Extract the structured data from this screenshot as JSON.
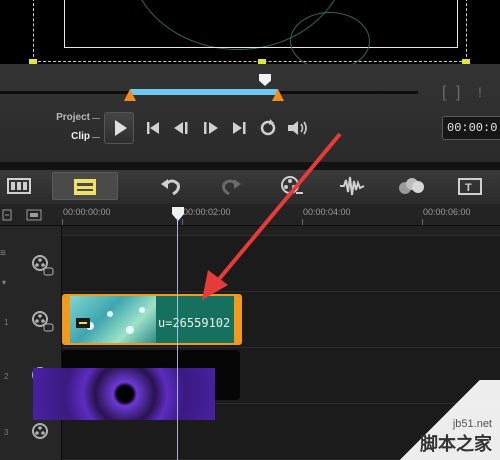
{
  "transport": {
    "project_label": "Project",
    "clip_label": "Clip",
    "timecode": "00:00:0",
    "bracket_in": "[",
    "bracket_out": "]"
  },
  "toolbar": {
    "items": [
      {
        "name": "timeline-view",
        "icon": "film-strip-icon"
      },
      {
        "name": "storyboard-view",
        "icon": "storyboard-icon"
      },
      {
        "name": "undo",
        "icon": "undo-icon"
      },
      {
        "name": "redo",
        "icon": "redo-icon"
      },
      {
        "name": "record",
        "icon": "film-reel-icon"
      },
      {
        "name": "audio-mix",
        "icon": "audio-wave-icon"
      },
      {
        "name": "auto-music",
        "icon": "spheres-icon"
      },
      {
        "name": "title",
        "icon": "title-icon"
      }
    ]
  },
  "ruler": {
    "labels": [
      "00:00:00:00",
      "00:00:02:00",
      "00:00:04:00",
      "00:00:06:00"
    ]
  },
  "clip": {
    "text": "u=26559102"
  },
  "watermark": {
    "site": "jb51.net",
    "name": "脚本之家"
  },
  "colors": {
    "accent_orange": "#f29a1c",
    "selection_blue": "#6ec6f2",
    "arrow_red": "#e53b3b"
  }
}
